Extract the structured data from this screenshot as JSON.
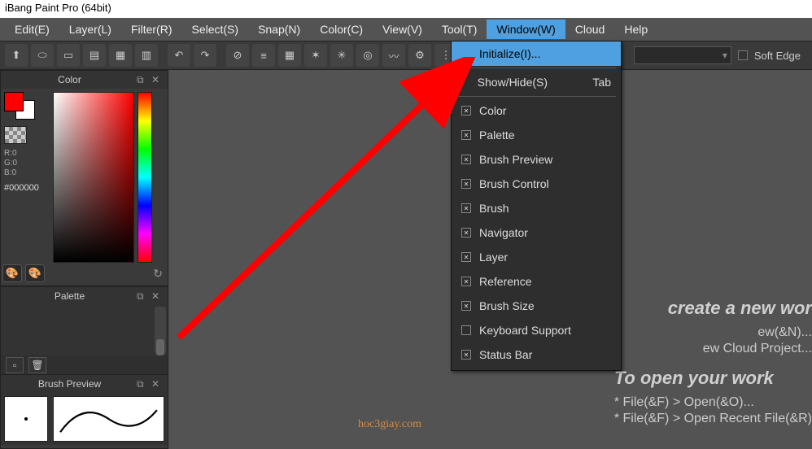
{
  "title": "iBang Paint Pro (64bit)",
  "menu": {
    "items": [
      "Edit(E)",
      "Layer(L)",
      "Filter(R)",
      "Select(S)",
      "Snap(N)",
      "Color(C)",
      "View(V)",
      "Tool(T)",
      "Window(W)",
      "Cloud",
      "Help"
    ],
    "active_index": 8
  },
  "toolbar": {
    "soft_edge_label": "Soft Edge"
  },
  "panels": {
    "color": {
      "title": "Color",
      "rgb": {
        "r": "R:0",
        "g": "G:0",
        "b": "B:0"
      },
      "hex": "#000000"
    },
    "palette": {
      "title": "Palette"
    },
    "brush_preview": {
      "title": "Brush Preview"
    }
  },
  "dropdown": {
    "initialize": "Initialize(I)...",
    "show_hide": "Show/Hide(S)",
    "show_hide_accel": "Tab",
    "items": [
      "Color",
      "Palette",
      "Brush Preview",
      "Brush Control",
      "Brush",
      "Navigator",
      "Layer",
      "Reference",
      "Brush Size",
      "Keyboard Support",
      "Status Bar"
    ]
  },
  "welcome": {
    "heading_create": "create a new wor",
    "line1": "ew(&N)...",
    "line2": "ew Cloud Project...",
    "heading_open": "To open your work",
    "line3": "* File(&F) > Open(&O)...",
    "line4": "* File(&F) > Open Recent File(&R)"
  },
  "watermark": "hoc3giay.com"
}
